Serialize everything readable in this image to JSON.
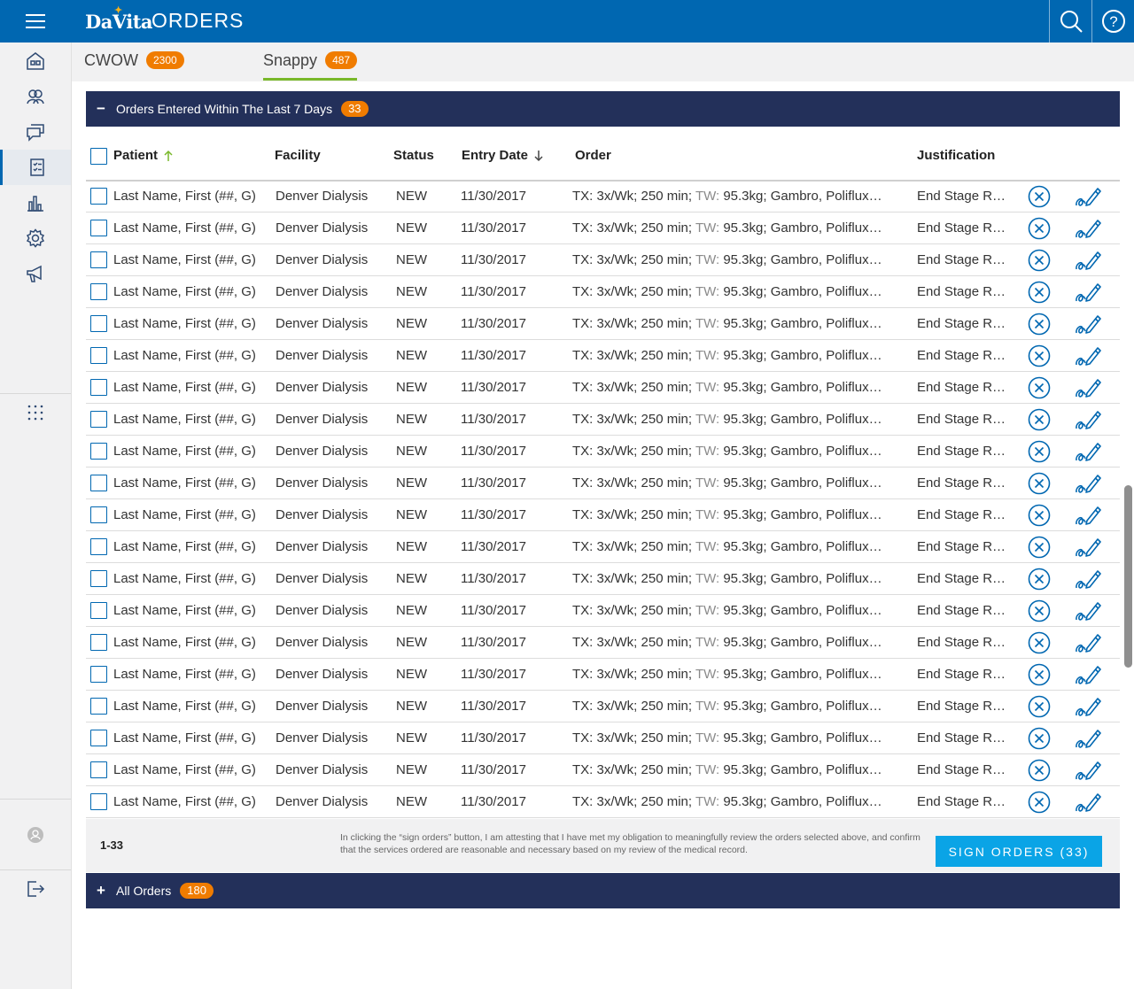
{
  "header": {
    "logo": "DaVita",
    "title": "ORDERS"
  },
  "colors": {
    "brand_blue": "#0067b1",
    "section_navy": "#23305a",
    "badge_orange": "#f07c00",
    "tab_active": "#79b82a",
    "sign_button": "#0aa4e6"
  },
  "sidebar": {
    "items": [
      {
        "icon": "home-icon"
      },
      {
        "icon": "patients-icon"
      },
      {
        "icon": "messages-icon"
      },
      {
        "icon": "orders-checklist-icon",
        "active": true
      },
      {
        "icon": "reports-chart-icon"
      },
      {
        "icon": "settings-gear-icon"
      },
      {
        "icon": "announcements-megaphone-icon"
      },
      {
        "icon": "apps-grid-icon"
      },
      {
        "icon": "user-avatar-icon"
      },
      {
        "icon": "logout-icon"
      }
    ]
  },
  "tabs": [
    {
      "label": "CWOW",
      "count": "2300",
      "active": false
    },
    {
      "label": "Snappy",
      "count": "487",
      "active": true
    }
  ],
  "section_recent": {
    "toggle": "−",
    "title": "Orders Entered Within The Last 7 Days",
    "count": "33"
  },
  "columns": {
    "patient": "Patient",
    "facility": "Facility",
    "status": "Status",
    "entry_date": "Entry Date",
    "order": "Order",
    "justification": "Justification"
  },
  "row_template": {
    "patient": "Last Name, First (##, G)",
    "facility": "Denver Dialysis",
    "status": "NEW",
    "entry_date": "11/30/2017",
    "order_tx": "TX: 3x/Wk; 250 min; ",
    "order_tw": "TW:",
    "order_rest": " 95.3kg; Gambro, Poliflux…",
    "justification": "End Stage R…"
  },
  "visible_row_count": 20,
  "footer": {
    "range": "1-33",
    "attestation": "In clicking the “sign orders” button, I am attesting that I have met my obligation to meaningfully review the orders selected above, and confirm that the services ordered are reasonable and necessary based on my review of the medical record.",
    "sign_label": "SIGN ORDERS (33)"
  },
  "section_all": {
    "toggle": "+",
    "title": "All Orders",
    "count": "180"
  }
}
